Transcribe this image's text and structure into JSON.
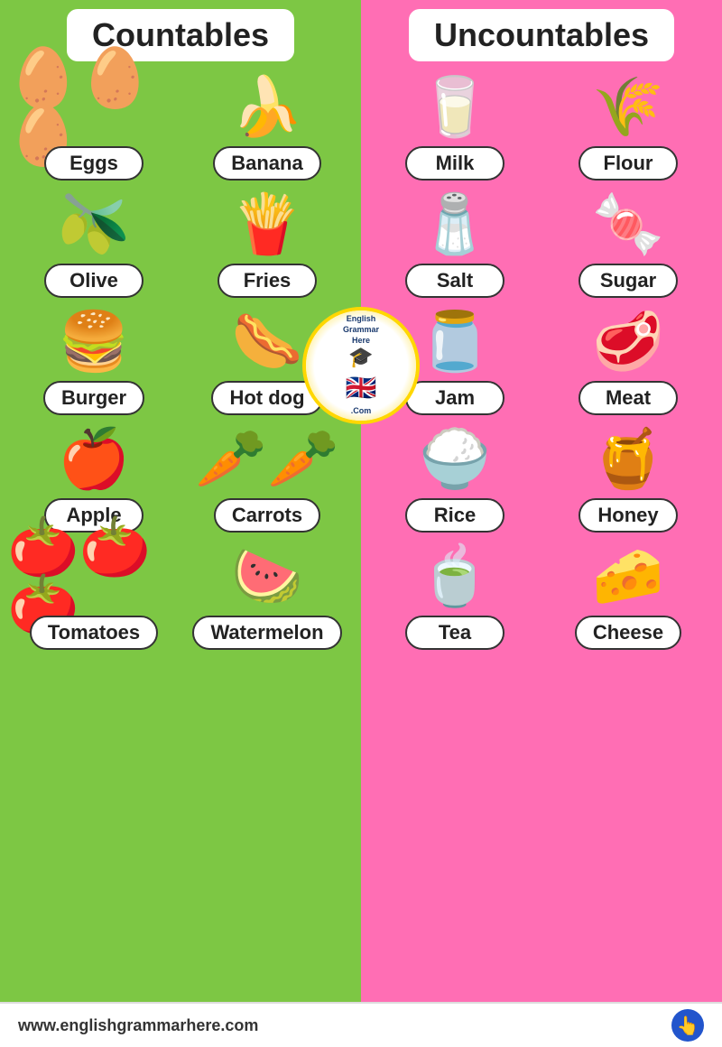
{
  "left": {
    "title": "Countables",
    "items": [
      {
        "label": "Eggs",
        "emoji": "🥚🥚🥚"
      },
      {
        "label": "Banana",
        "emoji": "🍌"
      },
      {
        "label": "Olive",
        "emoji": "🫒"
      },
      {
        "label": "Fries",
        "emoji": "🍟"
      },
      {
        "label": "Burger",
        "emoji": "🍔"
      },
      {
        "label": "Hot dog",
        "emoji": "🌭"
      },
      {
        "label": "Apple",
        "emoji": "🍎"
      },
      {
        "label": "Carrots",
        "emoji": "🥕🥕"
      },
      {
        "label": "Tomatoes",
        "emoji": "🍅🍅🍅"
      },
      {
        "label": "Watermelon",
        "emoji": "🍉"
      }
    ]
  },
  "right": {
    "title": "Uncountables",
    "items": [
      {
        "label": "Milk",
        "emoji": "🥛"
      },
      {
        "label": "Flour",
        "emoji": "🌾"
      },
      {
        "label": "Salt",
        "emoji": "🧂"
      },
      {
        "label": "Sugar",
        "emoji": "🍬"
      },
      {
        "label": "Jam",
        "emoji": "🫙"
      },
      {
        "label": "Meat",
        "emoji": "🥩"
      },
      {
        "label": "Rice",
        "emoji": "🍚"
      },
      {
        "label": "Honey",
        "emoji": "🍯"
      },
      {
        "label": "Tea",
        "emoji": "🍵"
      },
      {
        "label": "Cheese",
        "emoji": "🧀"
      }
    ]
  },
  "footer": {
    "url": "www.englishgrammarhere.com"
  },
  "logo": {
    "text": "English Grammar Here.Com"
  }
}
